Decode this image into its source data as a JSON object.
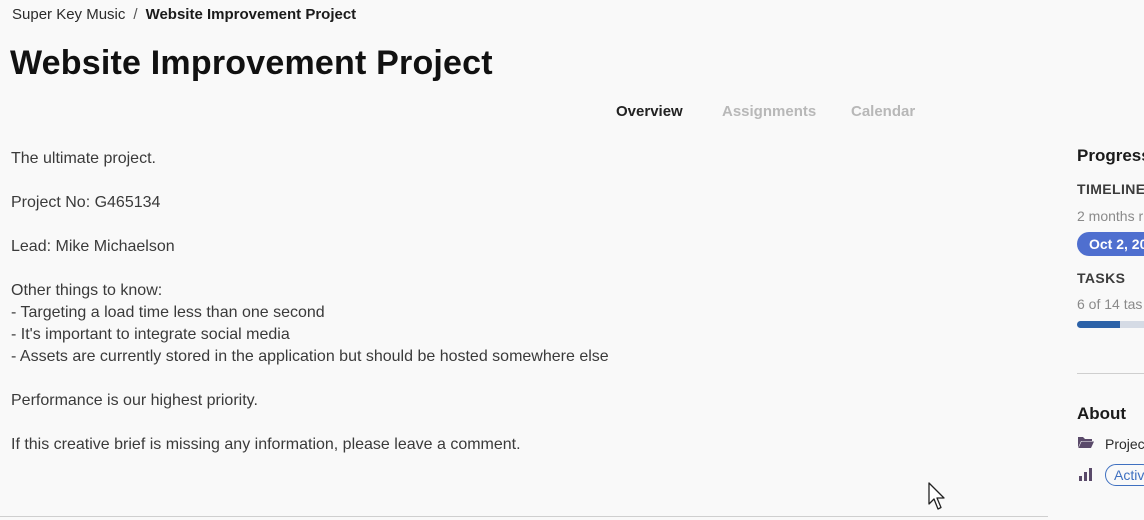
{
  "breadcrumb": {
    "parent": "Super Key Music",
    "separator": "/",
    "current": "Website Improvement Project"
  },
  "page_title": "Website Improvement Project",
  "tabs": [
    {
      "label": "Overview",
      "active": true
    },
    {
      "label": "Assignments",
      "active": false
    },
    {
      "label": "Calendar",
      "active": false
    }
  ],
  "description": {
    "intro": "The ultimate project.",
    "project_no": "Project No: G465134",
    "lead": "Lead: Mike Michaelson",
    "other_heading": "Other things to know:",
    "bullets": [
      "- Targeting a load time less than one second",
      "- It's important to integrate social media",
      "- Assets are currently stored in the application but should be hosted somewhere else"
    ],
    "priority": "Performance is our highest priority.",
    "closing": "If this creative brief is missing any information, please leave a comment."
  },
  "panel": {
    "heading": "Progress",
    "timeline_label": "TIMELINE",
    "timeline_remaining": "2 months r",
    "timeline_date": "Oct 2, 20",
    "tasks_label": "TASKS",
    "tasks_summary": "6 of 14 tas",
    "tasks_progress_fraction": 0.43,
    "about_heading": "About",
    "folder_label": "Project",
    "status_label": "Activ"
  },
  "colors": {
    "accent": "#4f6fcf",
    "progress": "#2c62a8",
    "status": "#3f70c0",
    "icon": "#5a4a6a"
  },
  "icons": {
    "folder": "folder-open-icon",
    "status": "bar-chart-icon",
    "cursor": "mouse-pointer"
  }
}
